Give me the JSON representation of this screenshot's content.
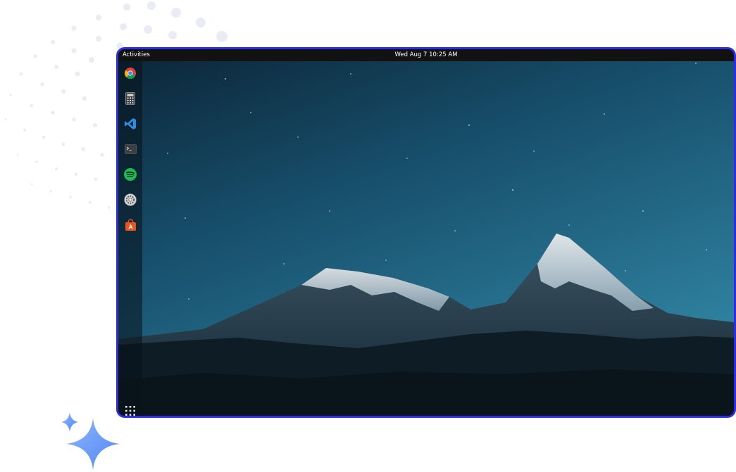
{
  "topbar": {
    "activities_label": "Activities",
    "clock": "Wed Aug 7 10:25 AM"
  },
  "dock": {
    "items": [
      {
        "icon": "chrome-icon"
      },
      {
        "icon": "calculator-icon"
      },
      {
        "icon": "vscode-icon"
      },
      {
        "icon": "terminal-icon"
      },
      {
        "icon": "spotify-icon"
      },
      {
        "icon": "settings-icon"
      },
      {
        "icon": "software-store-icon"
      }
    ],
    "apps_icon": "show-applications-icon"
  },
  "colors": {
    "screen_border": "#2c2ee6",
    "sky_top": "#0e2a3e",
    "sky_bottom": "#2a7594",
    "spotify_green": "#1db954",
    "vscode_blue": "#2a8ee6",
    "store_orange": "#e95420"
  }
}
